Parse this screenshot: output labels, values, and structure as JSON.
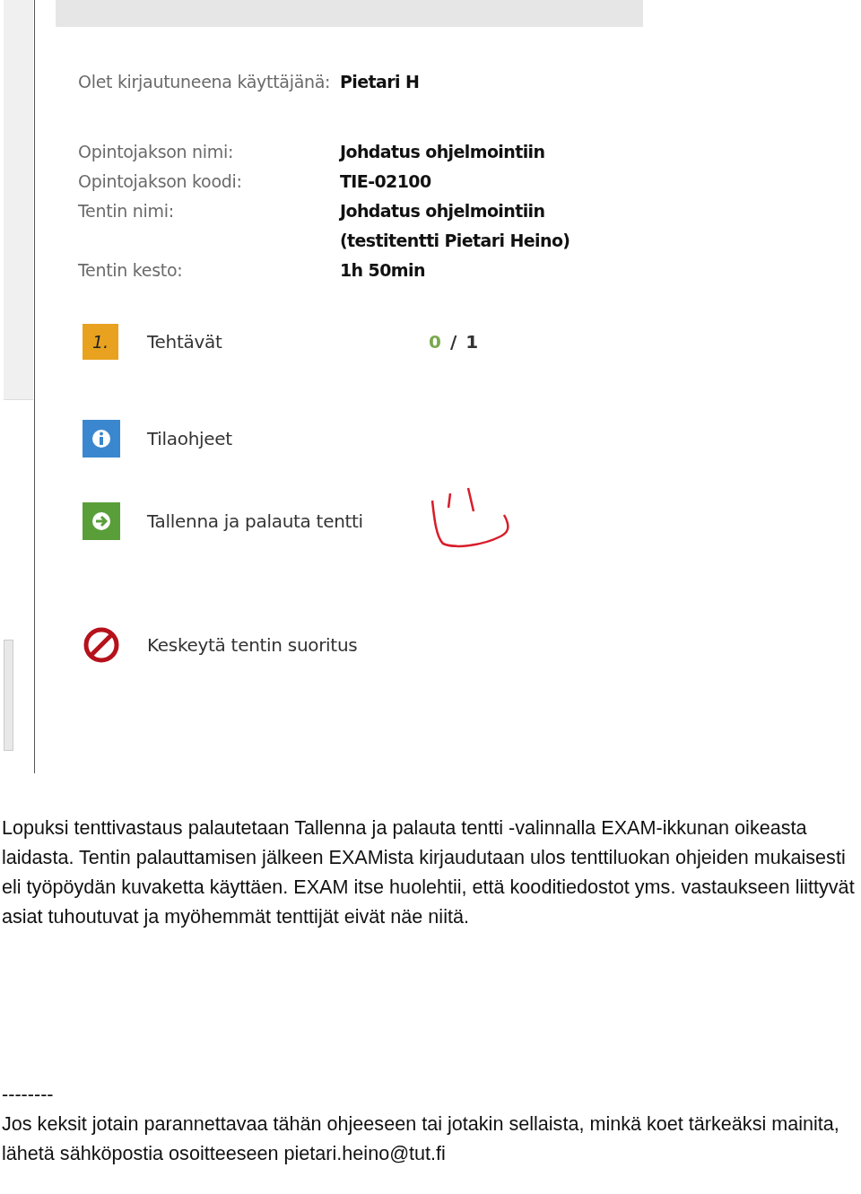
{
  "exam_panel": {
    "info": [
      {
        "label": "Olet kirjautuneena käyttäjänä:",
        "value": "Pietari H"
      },
      {
        "label": "Opintojakson nimi:",
        "value": "Johdatus ohjelmointiin"
      },
      {
        "label": "Opintojakson koodi:",
        "value": "TIE-02100"
      },
      {
        "label": "Tentin nimi:",
        "value": "Johdatus ohjelmointiin (testitentti Pietari Heino)"
      },
      {
        "label": "Tentin kesto:",
        "value": "1h 50min"
      }
    ],
    "menu": [
      {
        "kind": "tasks",
        "badge": "1.",
        "label": "Tehtävät",
        "progress": {
          "done": "0",
          "separator": "/",
          "total": "1"
        }
      },
      {
        "kind": "info",
        "label": "Tilaohjeet"
      },
      {
        "kind": "submit",
        "label": "Tallenna ja palauta tentti"
      },
      {
        "kind": "cancel",
        "label": "Keskeytä tentin suoritus"
      }
    ]
  },
  "body_text": "Lopuksi tenttivastaus palautetaan Tallenna ja palauta tentti -valinnalla EXAM-ikkunan oikeasta laidasta. Tentin palauttamisen jälkeen EXAMista kirjaudutaan ulos tenttiluokan ohjeiden mukaisesti eli työpöydän kuvaketta käyttäen. EXAM itse huolehtii, että kooditiedostot yms. vastaukseen liittyvät asiat tuhoutuvat ja myöhemmät tenttijät eivät näe niitä.",
  "separator": "--------",
  "footer_text": "Jos keksit jotain parannettavaa tähän ohjeeseen tai jotakin sellaista, minkä koet tärkeäksi mainita, lähetä sähköpostia osoitteeseen pietari.heino@tut.fi"
}
